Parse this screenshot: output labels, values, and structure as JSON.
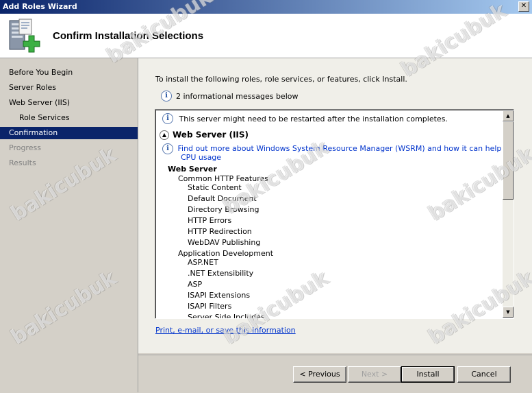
{
  "window": {
    "title": "Add Roles Wizard"
  },
  "header": {
    "title": "Confirm Installation Selections"
  },
  "sidebar": {
    "items": [
      {
        "label": "Before You Begin",
        "state": "normal",
        "sub": false
      },
      {
        "label": "Server Roles",
        "state": "normal",
        "sub": false
      },
      {
        "label": "Web Server (IIS)",
        "state": "normal",
        "sub": false
      },
      {
        "label": "Role Services",
        "state": "normal",
        "sub": true
      },
      {
        "label": "Confirmation",
        "state": "active",
        "sub": false
      },
      {
        "label": "Progress",
        "state": "disabled",
        "sub": false
      },
      {
        "label": "Results",
        "state": "disabled",
        "sub": false
      }
    ]
  },
  "main": {
    "intro": "To install the following roles, role services, or features, click Install.",
    "info_count": "2 informational messages below",
    "restart_note": "This server might need to be restarted after the installation completes.",
    "section_title": "Web Server (IIS)",
    "wsrm_link_line1": "Find out more about Windows System Resource Manager (WSRM) and how it can help optimize",
    "wsrm_link_line2": "CPU usage",
    "group_title": "Web Server",
    "features": [
      {
        "label": "Common HTTP Features",
        "level": 1
      },
      {
        "label": "Static Content",
        "level": 2
      },
      {
        "label": "Default Document",
        "level": 2
      },
      {
        "label": "Directory Browsing",
        "level": 2
      },
      {
        "label": "HTTP Errors",
        "level": 2
      },
      {
        "label": "HTTP Redirection",
        "level": 2
      },
      {
        "label": "WebDAV Publishing",
        "level": 2
      },
      {
        "label": "Application Development",
        "level": 1
      },
      {
        "label": "ASP.NET",
        "level": 2
      },
      {
        "label": ".NET Extensibility",
        "level": 2
      },
      {
        "label": "ASP",
        "level": 2
      },
      {
        "label": "ISAPI Extensions",
        "level": 2
      },
      {
        "label": "ISAPI Filters",
        "level": 2
      },
      {
        "label": "Server Side Includes",
        "level": 2
      }
    ],
    "print_link": "Print, e-mail, or save this information"
  },
  "buttons": {
    "previous": "< Previous",
    "next": "Next >",
    "install": "Install",
    "cancel": "Cancel"
  },
  "watermark": "bakicubuk"
}
